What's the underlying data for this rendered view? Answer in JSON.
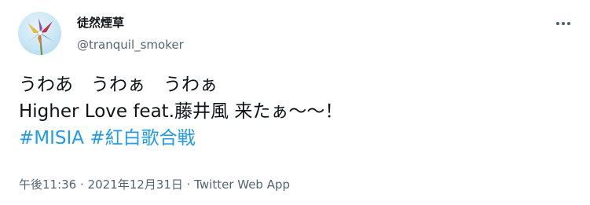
{
  "tweet": {
    "author": {
      "display_name": "徒然煙草",
      "handle": "@tranquil_smoker"
    },
    "text_lines": [
      "うわあ　うわぁ　うわぁ",
      "Higher Love feat.藤井風 来たぁ〜〜！"
    ],
    "hashtags": [
      "#MISIA",
      "#紅白歌合戦"
    ],
    "timestamp": "午後11:36 · 2021年12月31日",
    "separator": " · ",
    "source": "Twitter Web App"
  },
  "icons": {
    "avatar": "pinwheel-avatar",
    "more": "more-horizontal-icon"
  },
  "colors": {
    "hashtag": "#1d9bf0",
    "secondary_text": "#536471",
    "primary_text": "#0f1419"
  }
}
